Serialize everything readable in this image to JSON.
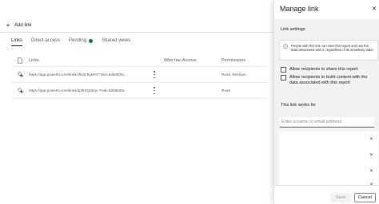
{
  "toolbar": {
    "add_link_label": "Add link"
  },
  "tabs": [
    {
      "label": "Links",
      "active": true
    },
    {
      "label": "Direct access",
      "active": false
    },
    {
      "label": "Pending",
      "active": false,
      "status_dot_color": "#107c41"
    },
    {
      "label": "Shared views",
      "active": false
    }
  ],
  "table": {
    "columns": [
      "Links",
      "Who has Access",
      "Permissions"
    ],
    "rows": [
      {
        "link": "https://app.powerbi.com/links/vfkIQ-8yMAY?ctid=5db6b0fa...",
        "who": "",
        "permissions": "Read, Reshare"
      },
      {
        "link": "https://app.powerbi.com/links/dpf5XQ2bqv-?ctid=5db6b0fa...",
        "who": "",
        "permissions": "Read"
      }
    ]
  },
  "panel": {
    "title": "Manage link",
    "link_settings_label": "Link settings",
    "info_text": "People with this link can view this report and use the data associated with it, regardless of its sensitivity label.",
    "options": [
      {
        "label": "Allow recipients to share this report",
        "checked": false
      },
      {
        "label": "Allow recipients to build content with the data associated with this report",
        "checked": false
      }
    ],
    "works_for_label": "This link works for",
    "recipient_placeholder": "Enter a name or email address",
    "recipient_count": 4,
    "save_label": "Save",
    "cancel_label": "Cancel"
  }
}
